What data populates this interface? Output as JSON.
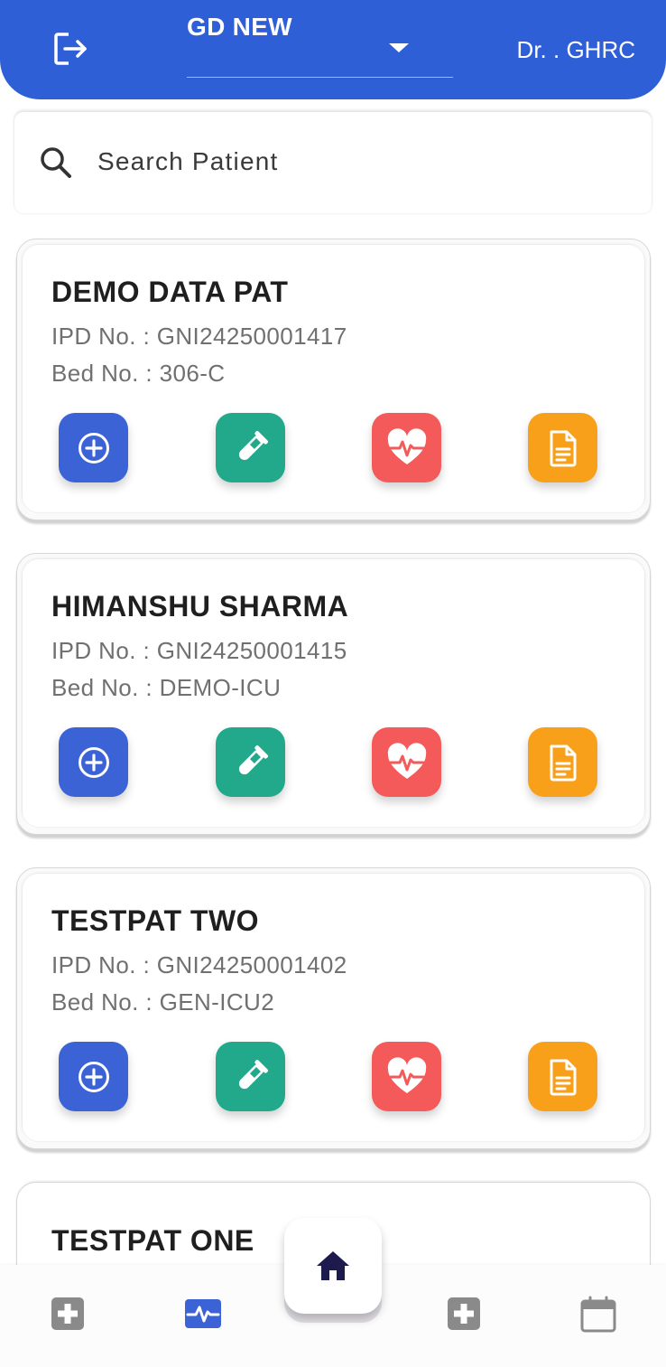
{
  "header": {
    "department": "GD NEW",
    "doctor": "Dr. . GHRC",
    "accent_color": "#2f5fd7"
  },
  "search": {
    "placeholder": "Search Patient",
    "value": ""
  },
  "patients": [
    {
      "name": "DEMO DATA PAT",
      "ipd": "IPD No. : GNI24250001417",
      "bed": "Bed No. : 306-C"
    },
    {
      "name": "HIMANSHU SHARMA",
      "ipd": "IPD No. : GNI24250001415",
      "bed": "Bed No. : DEMO-ICU"
    },
    {
      "name": "TESTPAT TWO",
      "ipd": "IPD No. : GNI24250001402",
      "bed": "Bed No. : GEN-ICU2"
    },
    {
      "name": "TESTPAT ONE"
    }
  ],
  "action_icons": [
    "add-circle-icon",
    "test-tube-icon",
    "heart-pulse-icon",
    "document-icon"
  ],
  "action_colors": {
    "add": "#3b63d6",
    "lab": "#22a88b",
    "vitals": "#f35a59",
    "report": "#f8a01a"
  },
  "bottom_nav": {
    "icons": [
      "medical-cross-icon",
      "vitals-monitor-icon",
      "home-icon",
      "medical-cross-icon",
      "calendar-icon"
    ],
    "active": "vitals-monitor-icon"
  }
}
